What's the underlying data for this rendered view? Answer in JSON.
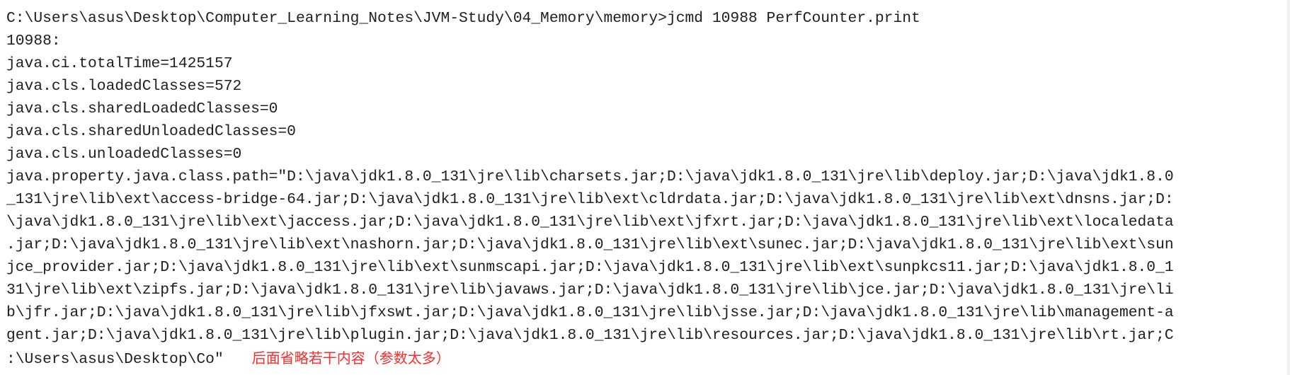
{
  "terminal": {
    "lines": [
      "C:\\Users\\asus\\Desktop\\Computer_Learning_Notes\\JVM-Study\\04_Memory\\memory>jcmd 10988 PerfCounter.print",
      "10988:",
      "java.ci.totalTime=1425157",
      "java.cls.loadedClasses=572",
      "java.cls.sharedLoadedClasses=0",
      "java.cls.sharedUnloadedClasses=0",
      "java.cls.unloadedClasses=0",
      "java.property.java.class.path=\"D:\\java\\jdk1.8.0_131\\jre\\lib\\charsets.jar;D:\\java\\jdk1.8.0_131\\jre\\lib\\deploy.jar;D:\\java\\jdk1.8.0",
      "_131\\jre\\lib\\ext\\access-bridge-64.jar;D:\\java\\jdk1.8.0_131\\jre\\lib\\ext\\cldrdata.jar;D:\\java\\jdk1.8.0_131\\jre\\lib\\ext\\dnsns.jar;D:",
      "\\java\\jdk1.8.0_131\\jre\\lib\\ext\\jaccess.jar;D:\\java\\jdk1.8.0_131\\jre\\lib\\ext\\jfxrt.jar;D:\\java\\jdk1.8.0_131\\jre\\lib\\ext\\localedata",
      ".jar;D:\\java\\jdk1.8.0_131\\jre\\lib\\ext\\nashorn.jar;D:\\java\\jdk1.8.0_131\\jre\\lib\\ext\\sunec.jar;D:\\java\\jdk1.8.0_131\\jre\\lib\\ext\\sun",
      "jce_provider.jar;D:\\java\\jdk1.8.0_131\\jre\\lib\\ext\\sunmscapi.jar;D:\\java\\jdk1.8.0_131\\jre\\lib\\ext\\sunpkcs11.jar;D:\\java\\jdk1.8.0_1",
      "31\\jre\\lib\\ext\\zipfs.jar;D:\\java\\jdk1.8.0_131\\jre\\lib\\javaws.jar;D:\\java\\jdk1.8.0_131\\jre\\lib\\jce.jar;D:\\java\\jdk1.8.0_131\\jre\\li",
      "b\\jfr.jar;D:\\java\\jdk1.8.0_131\\jre\\lib\\jfxswt.jar;D:\\java\\jdk1.8.0_131\\jre\\lib\\jsse.jar;D:\\java\\jdk1.8.0_131\\jre\\lib\\management-a",
      "gent.jar;D:\\java\\jdk1.8.0_131\\jre\\lib\\plugin.jar;D:\\java\\jdk1.8.0_131\\jre\\lib\\resources.jar;D:\\java\\jdk1.8.0_131\\jre\\lib\\rt.jar;C",
      ":\\Users\\asus\\Desktop\\Co\""
    ],
    "annotation": "后面省略若干内容（参数太多）",
    "colors": {
      "text": "#1e1e1e",
      "annotation": "#ff2a2a",
      "background": "#ffffff"
    }
  }
}
